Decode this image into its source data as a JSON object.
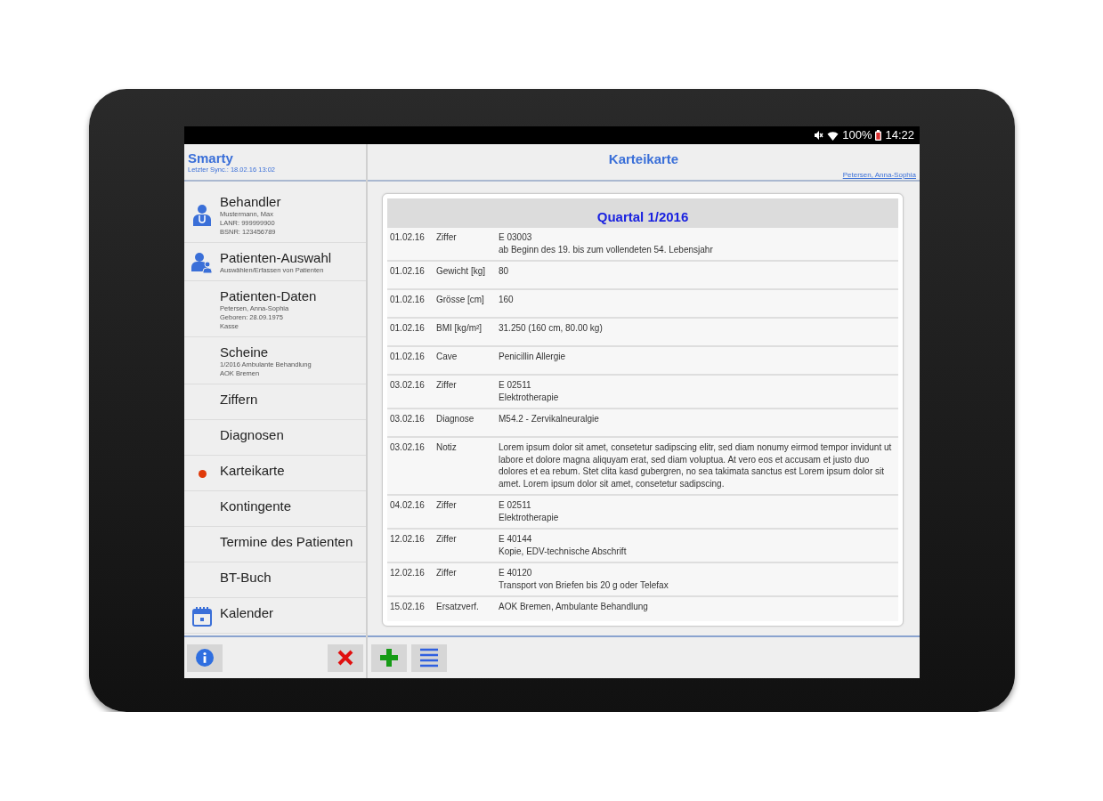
{
  "status_bar": {
    "battery": "100%",
    "time": "14:22"
  },
  "sidebar": {
    "title": "Smarty",
    "subtitle": "Letzter Sync.: 18.02.16 13:02",
    "items": [
      {
        "label": "Behandler",
        "kind": "doctor",
        "selected": false,
        "details": [
          "Mustermann, Max",
          "LANR: 999999900",
          "BSNR: 123456789"
        ]
      },
      {
        "label": "Patienten-Auswahl",
        "kind": "patients",
        "selected": false,
        "details": [
          "Auswählen/Erfassen von Patienten"
        ]
      },
      {
        "label": "Patienten-Daten",
        "kind": "plain",
        "selected": false,
        "details": [
          "Petersen, Anna-Sophia",
          "Geboren: 28.09.1975",
          "Kasse"
        ]
      },
      {
        "label": "Scheine",
        "kind": "plain",
        "selected": false,
        "details": [
          "1/2016 Ambulante Behandlung",
          "AOK Bremen"
        ]
      },
      {
        "label": "Ziffern",
        "kind": "plain",
        "selected": false
      },
      {
        "label": "Diagnosen",
        "kind": "plain",
        "selected": false
      },
      {
        "label": "Karteikarte",
        "kind": "plain",
        "selected": true
      },
      {
        "label": "Kontingente",
        "kind": "plain",
        "selected": false
      },
      {
        "label": "Termine des Patienten",
        "kind": "plain",
        "selected": false
      },
      {
        "label": "BT-Buch",
        "kind": "plain",
        "selected": false
      },
      {
        "label": "Kalender",
        "kind": "calendar",
        "selected": false
      }
    ]
  },
  "main": {
    "title": "Karteikarte",
    "patient": "Petersen, Anna-Sophia",
    "section": "Quartal 1/2016",
    "entries": [
      {
        "date": "01.02.16",
        "type": "Ziffer",
        "lines": [
          "E 03003",
          "ab Beginn des 19. bis zum vollendeten 54. Lebensjahr"
        ]
      },
      {
        "date": "01.02.16",
        "type": "Gewicht [kg]",
        "lines": [
          "80"
        ]
      },
      {
        "date": "01.02.16",
        "type": "Grösse [cm]",
        "lines": [
          "160"
        ]
      },
      {
        "date": "01.02.16",
        "type": "BMI [kg/m²]",
        "lines": [
          "31.250 (160 cm, 80.00 kg)"
        ]
      },
      {
        "date": "01.02.16",
        "type": "Cave",
        "lines": [
          "Penicillin Allergie"
        ]
      },
      {
        "date": "03.02.16",
        "type": "Ziffer",
        "lines": [
          "E 02511",
          "Elektrotherapie"
        ]
      },
      {
        "date": "03.02.16",
        "type": "Diagnose",
        "lines": [
          "M54.2 - Zervikalneuralgie"
        ]
      },
      {
        "date": "03.02.16",
        "type": "Notiz",
        "lines": [
          "Lorem ipsum dolor sit amet, consetetur sadipscing elitr, sed diam nonumy eirmod tempor invidunt ut labore et dolore magna aliquyam erat, sed diam voluptua. At vero eos et accusam et justo duo dolores et ea rebum. Stet clita kasd gubergren, no sea takimata sanctus est Lorem ipsum dolor sit amet. Lorem ipsum dolor sit amet, consetetur sadipscing."
        ]
      },
      {
        "date": "04.02.16",
        "type": "Ziffer",
        "lines": [
          "E 02511",
          "Elektrotherapie"
        ]
      },
      {
        "date": "12.02.16",
        "type": "Ziffer",
        "lines": [
          "E 40144",
          "Kopie, EDV-technische Abschrift"
        ]
      },
      {
        "date": "12.02.16",
        "type": "Ziffer",
        "lines": [
          "E 40120",
          "Transport von Briefen bis 20 g oder Telefax"
        ]
      },
      {
        "date": "15.02.16",
        "type": "Ersatzverf.",
        "lines": [
          "AOK Bremen, Ambulante Behandlung"
        ]
      }
    ]
  }
}
